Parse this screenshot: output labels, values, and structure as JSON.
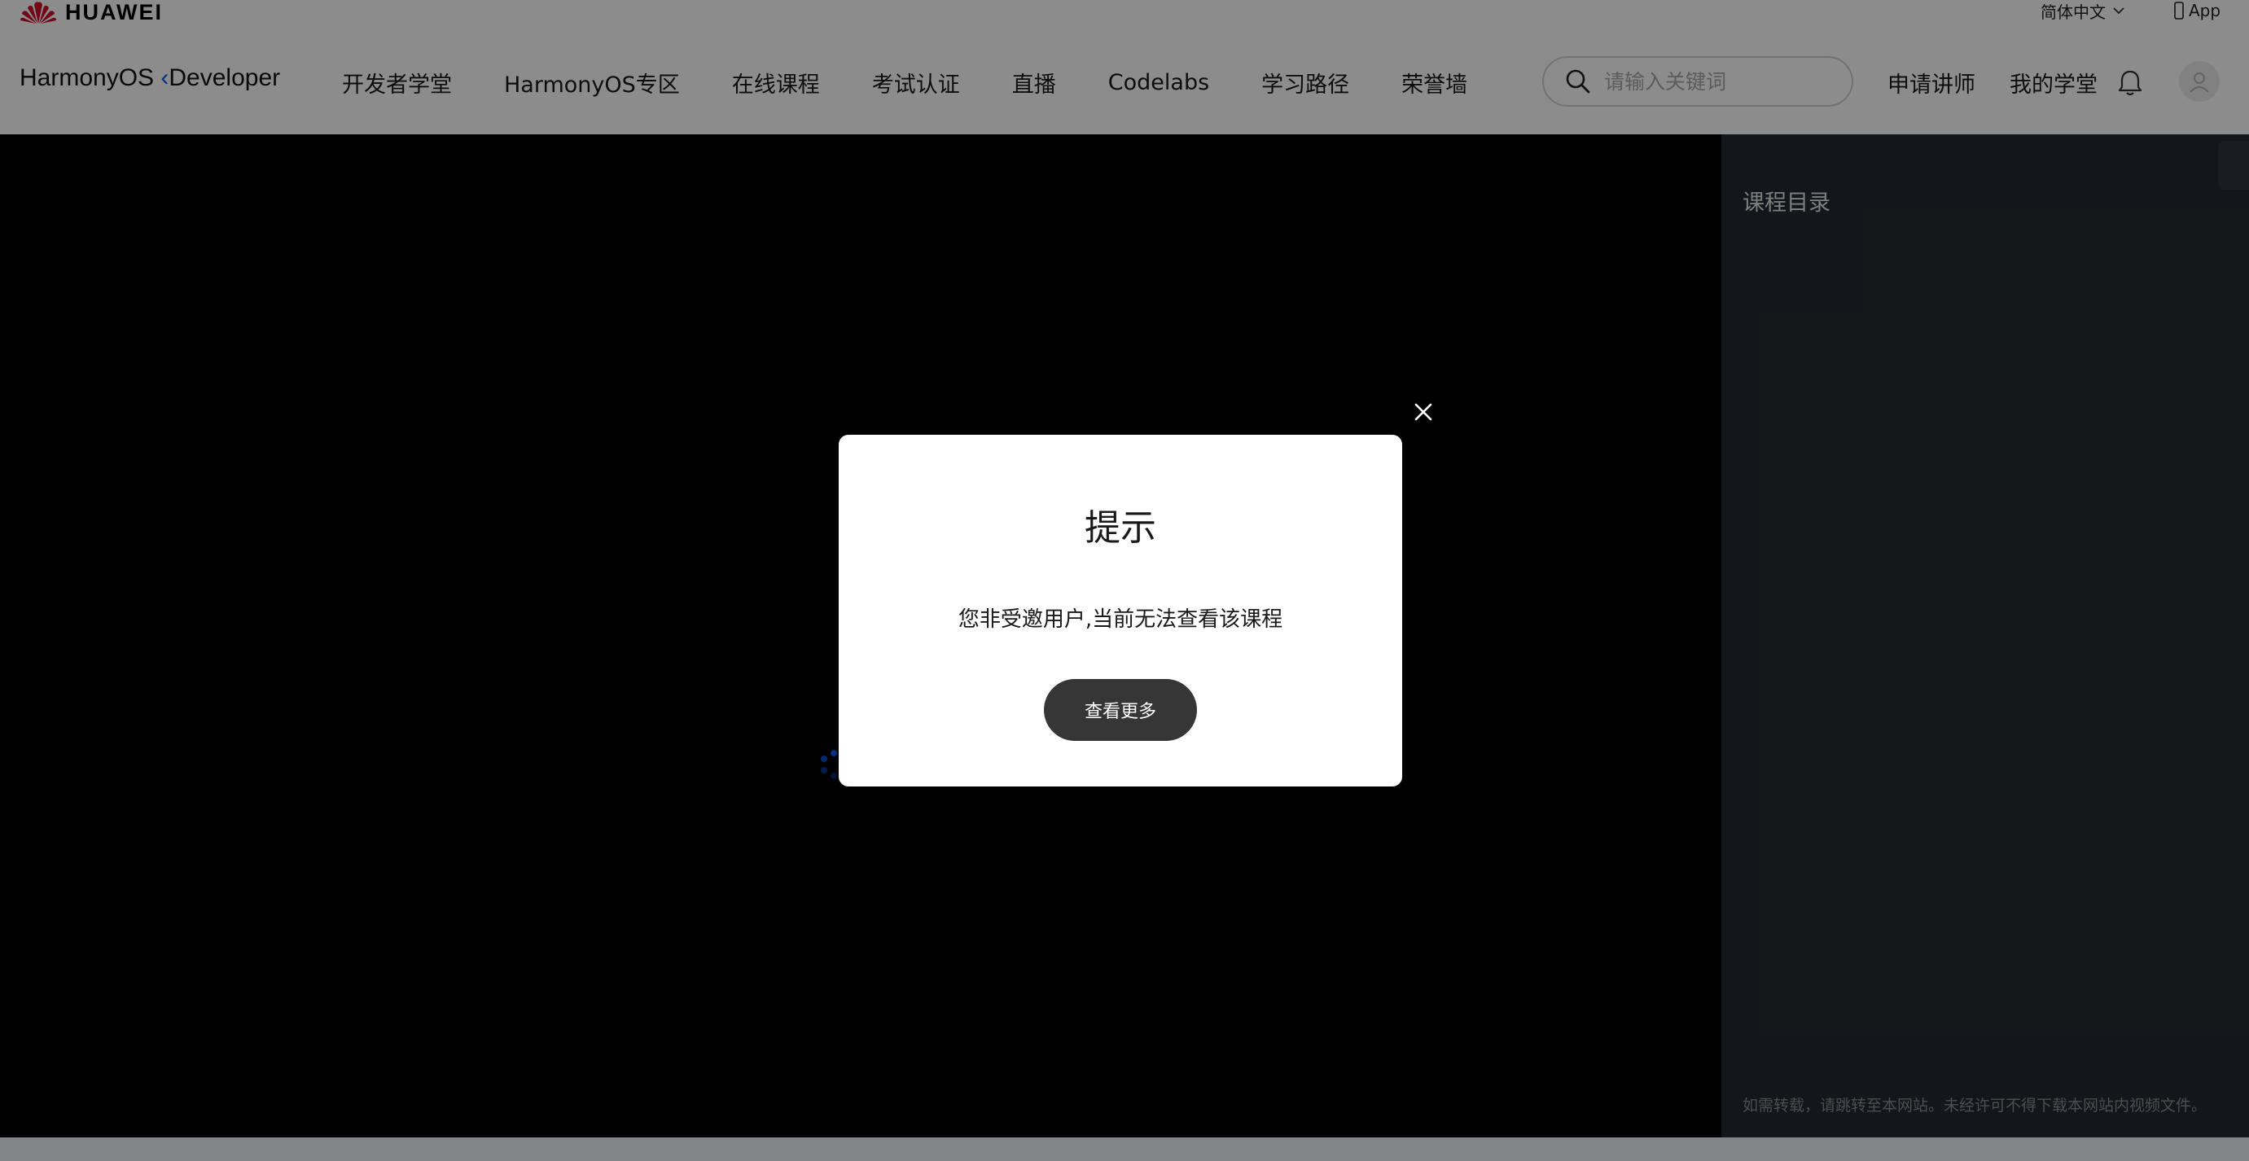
{
  "topbar": {
    "brand": "HUAWEI",
    "language": "简体中文",
    "app": "App"
  },
  "navbar": {
    "logo_main": "HarmonyOS",
    "logo_sub": "Developer",
    "items": [
      {
        "label": "开发者学堂"
      },
      {
        "label": "HarmonyOS专区"
      },
      {
        "label": "在线课程"
      },
      {
        "label": "考试认证"
      },
      {
        "label": "直播"
      },
      {
        "label": "Codelabs"
      },
      {
        "label": "学习路径"
      },
      {
        "label": "荣誉墙"
      }
    ],
    "search_placeholder": "请输入关键词",
    "apply_lecturer": "申请讲师",
    "my_school": "我的学堂"
  },
  "catalog": {
    "title": "课程目录",
    "notice": "如需转载，请跳转至本网站。未经许可不得下载本网站内视频文件。"
  },
  "modal": {
    "title": "提示",
    "message": "您非受邀用户,当前无法查看该课程",
    "button": "查看更多"
  },
  "colors": {
    "brand_red": "#cf0a2c",
    "accent_blue": "#0a59f7",
    "modal_button": "#363636",
    "sidebar_bg": "#262932"
  }
}
